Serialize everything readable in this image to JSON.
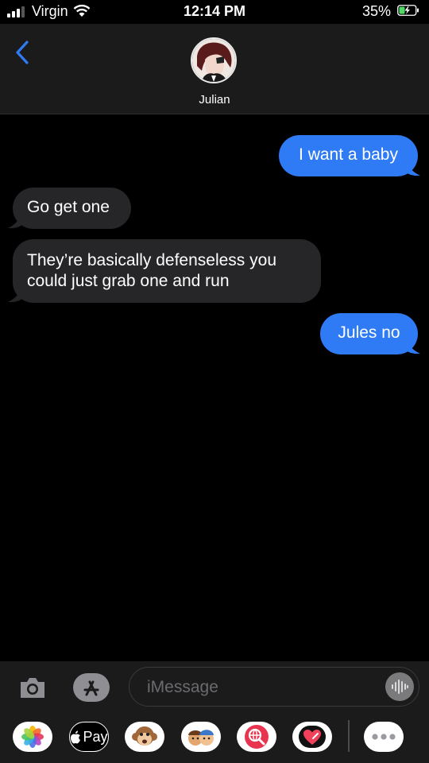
{
  "status_bar": {
    "carrier": "Virgin",
    "time": "12:14 PM",
    "battery_percent": "35%"
  },
  "header": {
    "contact_name": "Julian",
    "avatar": "avatar-illustration"
  },
  "messages": [
    {
      "direction": "outgoing",
      "text": "I want a baby"
    },
    {
      "direction": "incoming",
      "text": "Go get one"
    },
    {
      "direction": "incoming",
      "lines": [
        "They’re basically defenseless you",
        "could just grab one and run"
      ]
    },
    {
      "direction": "outgoing",
      "text": "Jules no"
    }
  ],
  "input_bar": {
    "placeholder": "iMessage"
  },
  "app_tray": {
    "apple_pay_label": "Pay"
  },
  "colors": {
    "outgoing_bubble": "#2f7bf5",
    "incoming_bubble": "#262628",
    "accent": "#2f7bf5"
  }
}
